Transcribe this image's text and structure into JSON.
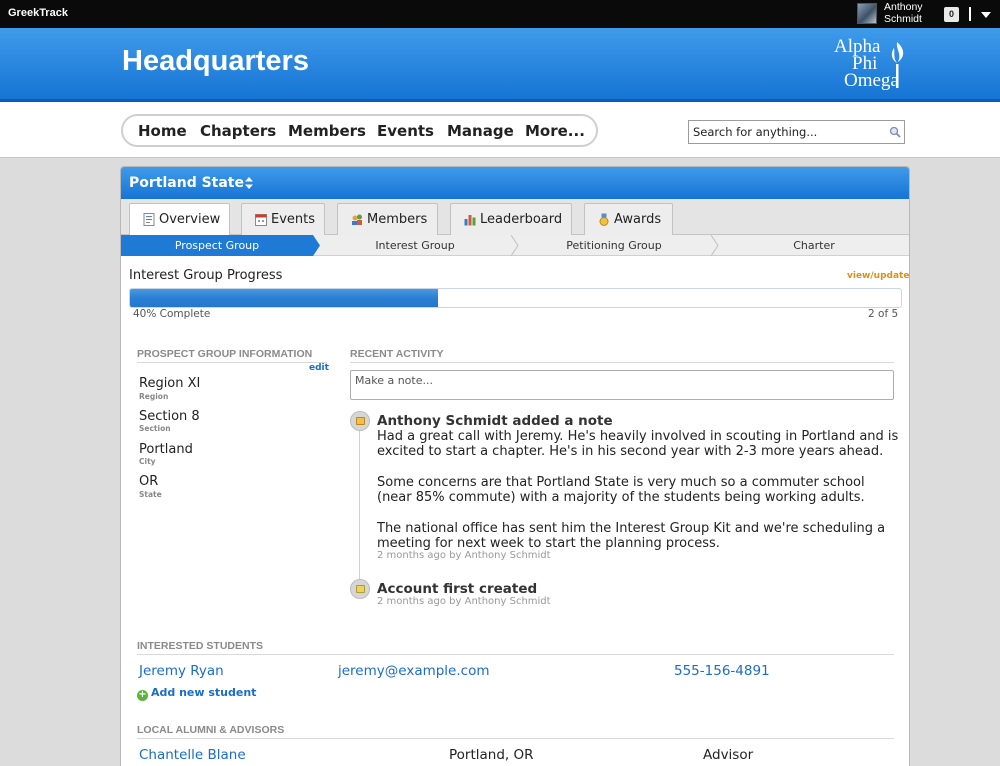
{
  "topbar": {
    "brand": "GreekTrack",
    "user_first": "Anthony",
    "user_last": "Schmidt",
    "notifications": "0"
  },
  "header": {
    "title": "Headquarters",
    "logo_line1": "Alpha",
    "logo_line2": "Phi",
    "logo_line3": "Omega"
  },
  "nav": {
    "items": [
      "Home",
      "Chapters",
      "Members",
      "Events",
      "Manage",
      "More..."
    ]
  },
  "search": {
    "placeholder": "Search for anything..."
  },
  "panel": {
    "title": "Portland State",
    "tabs": [
      "Overview",
      "Events",
      "Members",
      "Leaderboard",
      "Awards"
    ],
    "steps": [
      "Prospect Group",
      "Interest Group",
      "Petitioning Group",
      "Charter"
    ],
    "active_step": "Prospect Group"
  },
  "progress": {
    "label": "Interest Group Progress",
    "link": "view/update",
    "percent": 40,
    "percent_text": "40% Complete",
    "count_text": "2 of 5"
  },
  "info": {
    "heading": "PROSPECT GROUP INFORMATION",
    "edit": "edit",
    "fields": [
      {
        "value": "Region XI",
        "label": "Region"
      },
      {
        "value": "Section 8",
        "label": "Section"
      },
      {
        "value": "Portland",
        "label": "City"
      },
      {
        "value": "OR",
        "label": "State"
      }
    ]
  },
  "activity": {
    "heading": "RECENT ACTIVITY",
    "note_placeholder": "Make a note...",
    "items": [
      {
        "title": "Anthony Schmidt added a note",
        "p1": "Had a great call with Jeremy. He's heavily involved in scouting in Portland and is excited to start a chapter. He's in his second year with 2-3 more years ahead.",
        "p2": "Some concerns are that Portland State is very much so a commuter school (near 85% commute) with a majority of the students being working adults.",
        "p3": "The national office has sent him the Interest Group Kit and we're scheduling a meeting for next week to start the planning process.",
        "meta": "2 months ago by Anthony Schmidt"
      },
      {
        "title": "Account first created",
        "meta": "2 months ago by Anthony Schmidt"
      }
    ]
  },
  "students": {
    "heading": "INTERESTED STUDENTS",
    "rows": [
      {
        "name": "Jeremy Ryan",
        "email": "jeremy@example.com",
        "phone": "555-156-4891"
      }
    ],
    "add_label": "Add new student"
  },
  "alumni": {
    "heading": "LOCAL ALUMNI & ADVISORS",
    "rows": [
      {
        "name": "Chantelle Blane",
        "location": "Portland, OR",
        "role": "Advisor"
      }
    ]
  },
  "colors": {
    "header_blue": "#1674d4",
    "link_blue": "#1a6dc8",
    "accent_orange": "#d9901a",
    "progress_blue": "#2a7fd3"
  }
}
